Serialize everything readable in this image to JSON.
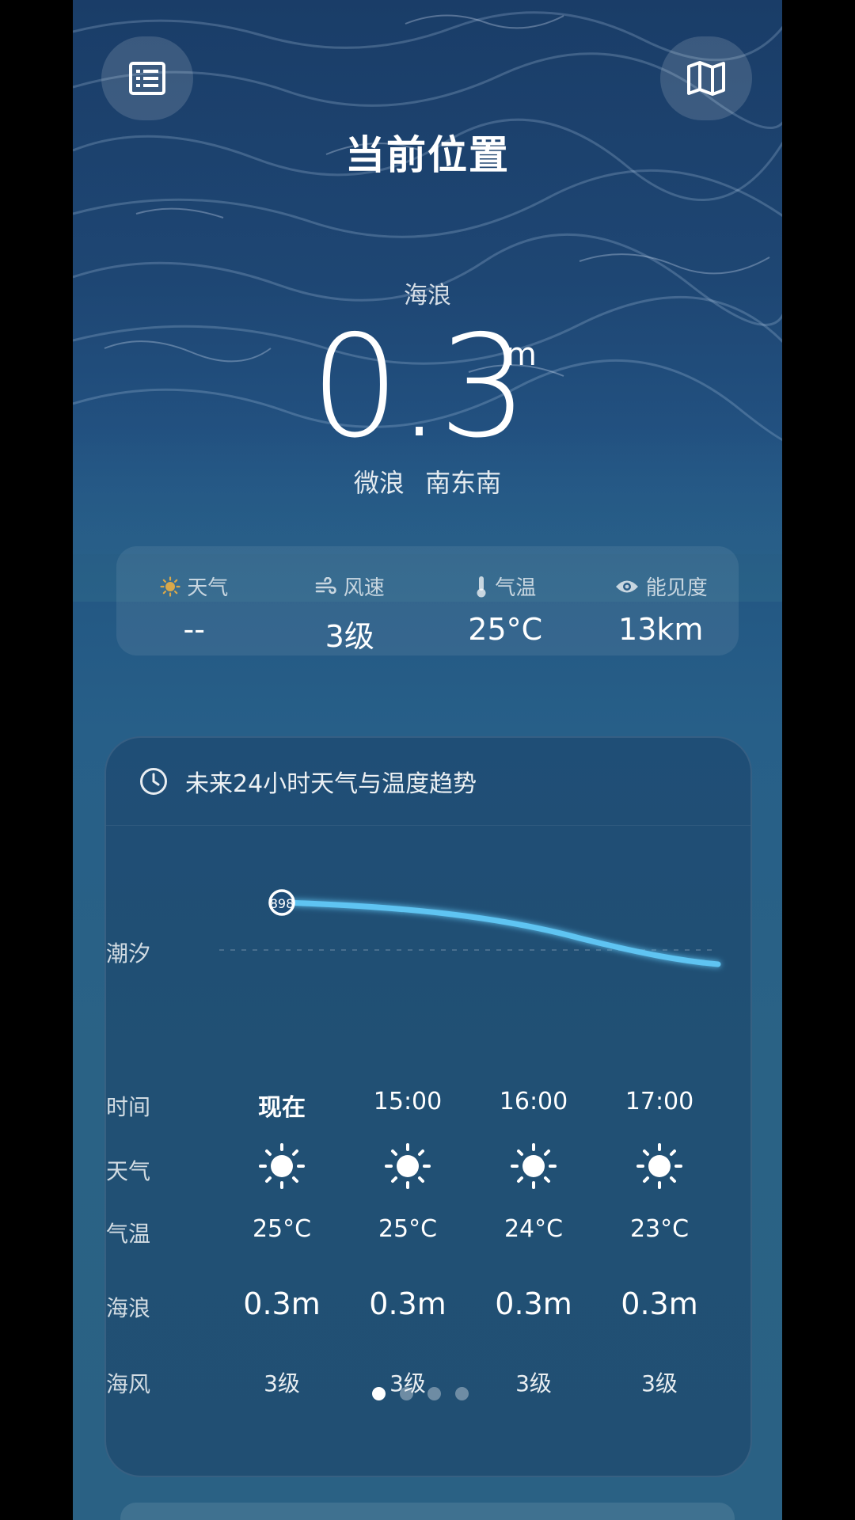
{
  "header": {
    "title": "当前位置",
    "list_icon": "list-icon",
    "map_icon": "map-icon"
  },
  "wave": {
    "label": "海浪",
    "value": "0.3",
    "unit": "m",
    "level": "微浪",
    "direction": "南东南"
  },
  "stats": [
    {
      "icon": "sun-icon",
      "label": "天气",
      "value": "--"
    },
    {
      "icon": "wind-icon",
      "label": "风速",
      "value": "3级"
    },
    {
      "icon": "thermometer-icon",
      "label": "气温",
      "value": "25°C"
    },
    {
      "icon": "eye-icon",
      "label": "能见度",
      "value": "13km"
    }
  ],
  "forecast": {
    "title": "未来24小时天气与温度趋势",
    "clock_icon": "clock-icon",
    "tide_label": "潮汐",
    "tide_marker": "898",
    "row_labels": {
      "time": "时间",
      "weather": "天气",
      "temp": "气温",
      "wave": "海浪",
      "wind": "海风"
    },
    "columns": [
      {
        "time": "现在",
        "weather_icon": "sun-icon",
        "temp": "25°C",
        "wave": "0.3m",
        "wind": "3级"
      },
      {
        "time": "15:00",
        "weather_icon": "sun-icon",
        "temp": "25°C",
        "wave": "0.3m",
        "wind": "3级"
      },
      {
        "time": "16:00",
        "weather_icon": "sun-icon",
        "temp": "24°C",
        "wave": "0.3m",
        "wind": "3级"
      },
      {
        "time": "17:00",
        "weather_icon": "sun-icon",
        "temp": "23°C",
        "wave": "0.3m",
        "wind": "3级"
      }
    ],
    "pager": {
      "count": 4,
      "active": 0
    }
  },
  "colors": {
    "accent": "#5fc4f2",
    "background": "#2a6184"
  }
}
